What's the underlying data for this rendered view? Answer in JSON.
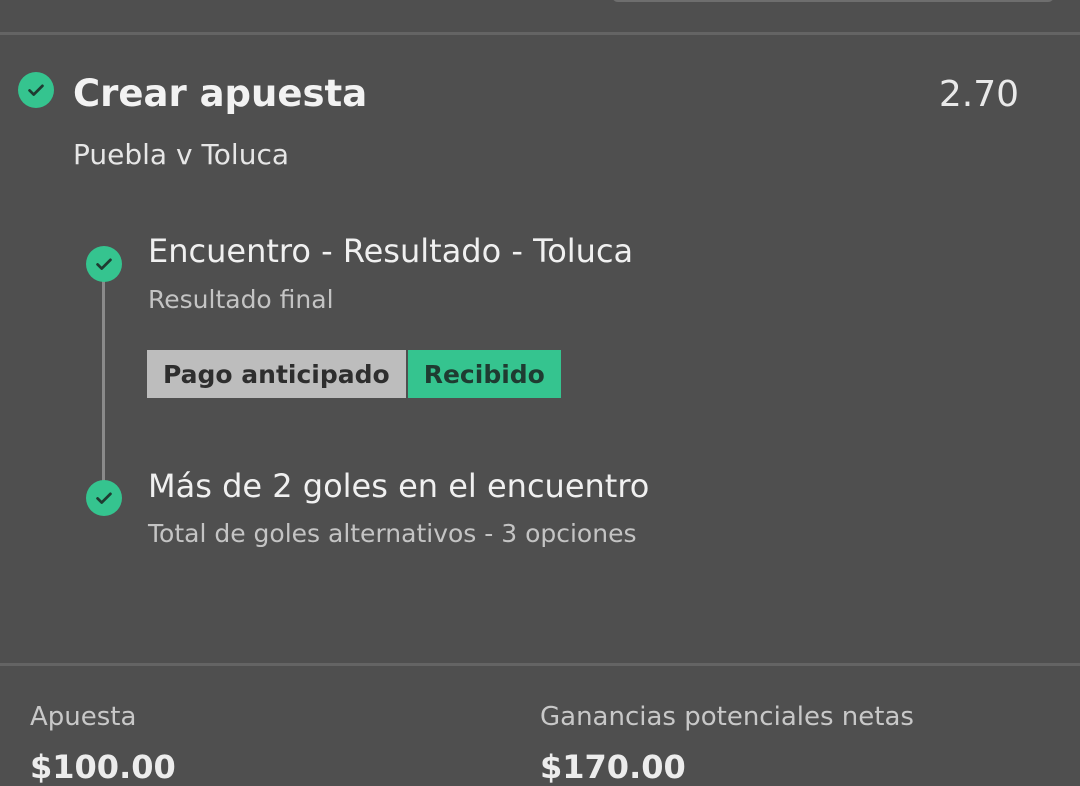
{
  "bet": {
    "title": "Crear apuesta",
    "odds": "2.70",
    "match": "Puebla v Toluca"
  },
  "legs": [
    {
      "title": "Encuentro - Resultado - Toluca",
      "subtitle": "Resultado final",
      "tags": [
        {
          "label": "Pago anticipado"
        },
        {
          "label": "Recibido"
        }
      ]
    },
    {
      "title": "Más de 2 goles en el encuentro",
      "subtitle": "Total de goles alternativos - 3 opciones"
    }
  ],
  "footer": {
    "stake_label": "Apuesta",
    "stake_value": "$100.00",
    "returns_label": "Ganancias potenciales netas",
    "returns_value": "$170.00"
  },
  "icons": {
    "status": "check-circle-icon"
  },
  "colors": {
    "background": "#4f4f4f",
    "accent_green": "#35c48f",
    "tag_grey": "#bdbdbd"
  }
}
